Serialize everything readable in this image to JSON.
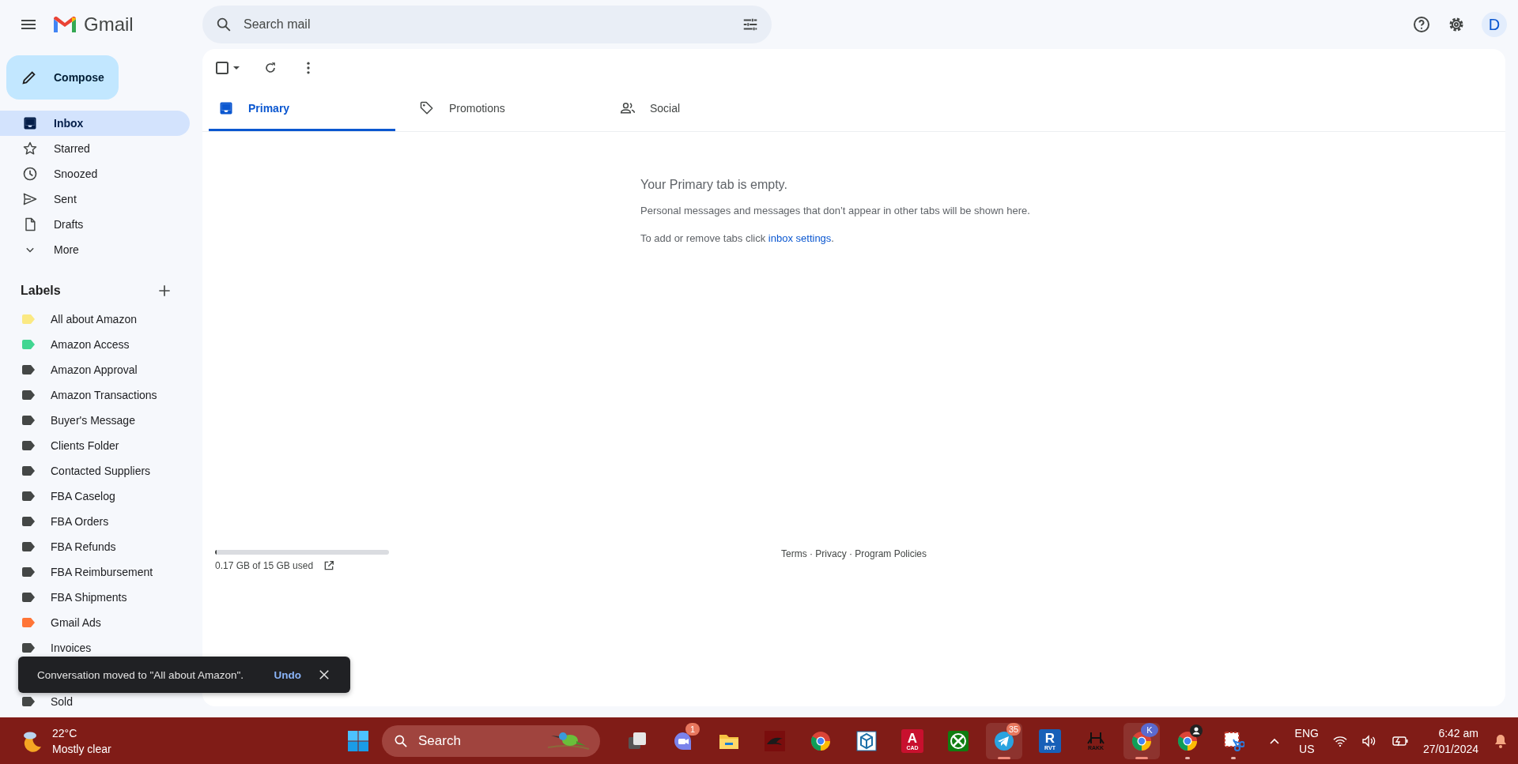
{
  "header": {
    "app_name": "Gmail",
    "search": {
      "placeholder": "Search mail"
    },
    "avatar_initial": "D"
  },
  "compose": "Compose",
  "nav": [
    {
      "label": "Inbox",
      "kind": "inbox",
      "selected": true
    },
    {
      "label": "Starred",
      "kind": "star",
      "selected": false
    },
    {
      "label": "Snoozed",
      "kind": "clock",
      "selected": false
    },
    {
      "label": "Sent",
      "kind": "send",
      "selected": false
    },
    {
      "label": "Drafts",
      "kind": "file",
      "selected": false
    },
    {
      "label": "More",
      "kind": "chevron",
      "selected": false
    }
  ],
  "labels_heading": "Labels",
  "labels": [
    {
      "name": "All about Amazon",
      "color": "#fbe983"
    },
    {
      "name": "Amazon Access",
      "color": "#42d692"
    },
    {
      "name": "Amazon Approval",
      "color": "#444746"
    },
    {
      "name": "Amazon Transactions",
      "color": "#444746"
    },
    {
      "name": "Buyer's Message",
      "color": "#444746"
    },
    {
      "name": "Clients Folder",
      "color": "#444746"
    },
    {
      "name": "Contacted Suppliers",
      "color": "#444746"
    },
    {
      "name": "FBA Caselog",
      "color": "#444746"
    },
    {
      "name": "FBA Orders",
      "color": "#444746"
    },
    {
      "name": "FBA Refunds",
      "color": "#444746"
    },
    {
      "name": "FBA Reimbursement",
      "color": "#444746"
    },
    {
      "name": "FBA Shipments",
      "color": "#444746"
    },
    {
      "name": "Gmail Ads",
      "color": "#ff7537"
    },
    {
      "name": "Invoices",
      "color": "#444746"
    },
    {
      "name": "Sold",
      "color": "#444746"
    }
  ],
  "toolbar": {
    "select_all_checked": false
  },
  "tabs": [
    {
      "label": "Primary",
      "kind": "inbox",
      "selected": true
    },
    {
      "label": "Promotions",
      "kind": "tag",
      "selected": false
    },
    {
      "label": "Social",
      "kind": "people",
      "selected": false
    }
  ],
  "empty": {
    "title": "Your Primary tab is empty.",
    "body": "Personal messages and messages that don’t appear in other tabs will be shown here.",
    "hint": "To add or remove tabs click",
    "link": "inbox settings",
    "hint_end": "."
  },
  "storage": {
    "level": 0.011,
    "text": "0.17 GB of 15 GB used"
  },
  "footer": "Terms · Privacy · Program Policies",
  "toast": {
    "message": "Conversation moved to \"All about Amazon\".",
    "action": "Undo"
  },
  "taskbar": {
    "weather": {
      "temp": "22°C",
      "condition": "Mostly clear"
    },
    "search_placeholder": "Search",
    "apps": [
      {
        "kind": "taskview",
        "running": false,
        "active": false
      },
      {
        "kind": "chat",
        "badge": "1",
        "running": false,
        "active": false
      },
      {
        "kind": "folder",
        "running": false,
        "active": false
      },
      {
        "kind": "dragon",
        "running": false,
        "active": false
      },
      {
        "kind": "chrome",
        "running": false,
        "active": false
      },
      {
        "kind": "cube",
        "running": false,
        "active": false
      },
      {
        "kind": "autocad",
        "glyph": "A",
        "caption": "CAD",
        "running": false,
        "active": false
      },
      {
        "kind": "xbox",
        "running": false,
        "active": false
      },
      {
        "kind": "telegram",
        "badge": "35",
        "running": true,
        "active": true
      },
      {
        "kind": "revit",
        "glyph": "R",
        "caption": "RVT",
        "running": false,
        "active": false
      },
      {
        "kind": "rakk",
        "caption": "RAKK",
        "running": false,
        "active": false
      },
      {
        "kind": "chrome",
        "badge": "K",
        "running": true,
        "active": true
      },
      {
        "kind": "chrome-profile",
        "running": true,
        "active": false
      },
      {
        "kind": "snip",
        "running": true,
        "active": false
      }
    ],
    "language": "ENG",
    "region": "US",
    "time": "6:42 am",
    "date": "27/01/2024"
  }
}
